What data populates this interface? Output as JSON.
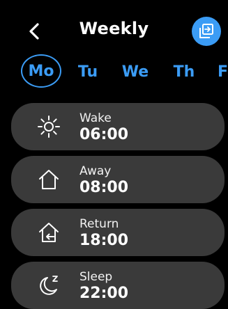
{
  "header": {
    "title": "Weekly",
    "back_icon": "chevron-left-icon",
    "copy_icon": "copy-schedule-icon",
    "accent": "#3b9cf5"
  },
  "days": [
    {
      "label": "Mo",
      "active": true
    },
    {
      "label": "Tu",
      "active": false
    },
    {
      "label": "We",
      "active": false
    },
    {
      "label": "Th",
      "active": false
    },
    {
      "label": "F",
      "active": false
    }
  ],
  "schedule": [
    {
      "label": "Wake",
      "time": "06:00",
      "icon": "sun-icon"
    },
    {
      "label": "Away",
      "time": "08:00",
      "icon": "house-icon"
    },
    {
      "label": "Return",
      "time": "18:00",
      "icon": "home-return-icon"
    },
    {
      "label": "Sleep",
      "time": "22:00",
      "icon": "moon-sleep-icon"
    }
  ],
  "colors": {
    "background": "#000000",
    "card": "#3a3a3a",
    "day_text": "#3b9cf5",
    "text": "#ffffff"
  }
}
